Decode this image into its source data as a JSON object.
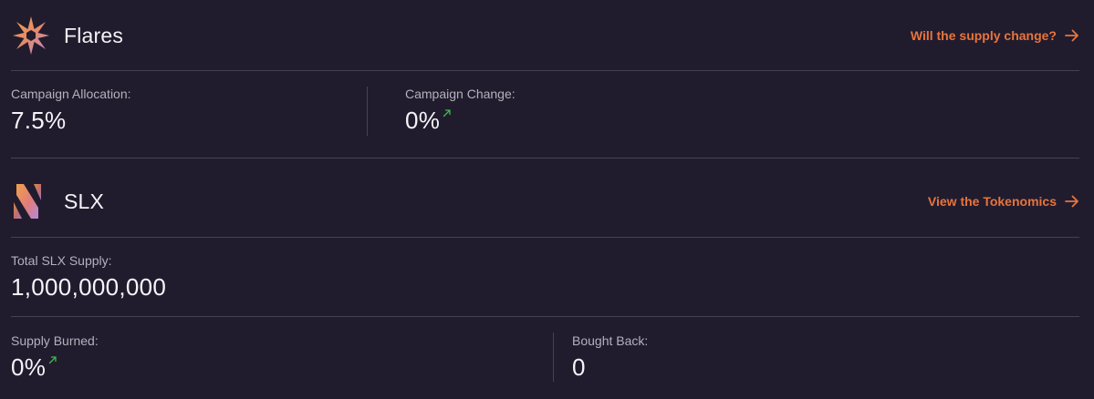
{
  "flares": {
    "title": "Flares",
    "logo_icon": "flares-star-icon",
    "link_label": "Will the supply change?",
    "allocation": {
      "label": "Campaign Allocation:",
      "value": "7.5%"
    },
    "change": {
      "label": "Campaign Change:",
      "value": "0%",
      "trend_icon": "trend-up-icon"
    }
  },
  "slx": {
    "title": "SLX",
    "logo_icon": "slx-logo-icon",
    "link_label": "View the Tokenomics",
    "total_supply": {
      "label": "Total SLX Supply:",
      "value": "1,000,000,000"
    },
    "supply_burned": {
      "label": "Supply Burned:",
      "value": "0%",
      "trend_icon": "trend-up-icon"
    },
    "bought_back": {
      "label": "Bought Back:",
      "value": "0"
    }
  },
  "colors": {
    "background": "#211c2d",
    "accent": "#e8743d",
    "divider": "#47414f",
    "trend_up": "#3fb950"
  }
}
